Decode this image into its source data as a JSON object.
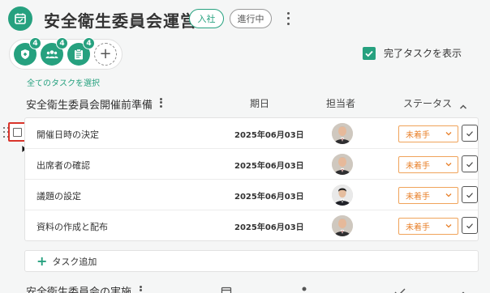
{
  "header": {
    "title": "安全衛生委員会運営",
    "join_label": "入社",
    "progress_label": "進行中"
  },
  "filters": {
    "badges": [
      "4",
      "4",
      "4"
    ],
    "icons": [
      "shield-plus-icon",
      "group-icon",
      "clipboard-icon"
    ],
    "add": "+"
  },
  "show_completed": {
    "label": "完了タスクを表示",
    "checked": true
  },
  "select_all_label": "全てのタスクを選択",
  "section": {
    "title": "安全衛生委員会開催前準備",
    "columns": {
      "date": "期日",
      "assignee": "担当者",
      "status": "ステータス"
    }
  },
  "tasks": [
    {
      "name": "開催日時の決定",
      "date": "2025年06月03日",
      "status": "未着手"
    },
    {
      "name": "出席者の確認",
      "date": "2025年06月03日",
      "status": "未着手"
    },
    {
      "name": "議題の設定",
      "date": "2025年06月03日",
      "status": "未着手"
    },
    {
      "name": "資料の作成と配布",
      "date": "2025年06月03日",
      "status": "未着手"
    }
  ],
  "add_task_label": "タスク追加",
  "next_section": {
    "title": "安全衛生委員会の実施"
  },
  "colors": {
    "accent": "#26a17f",
    "status_orange": "#e8802a",
    "highlight_red": "#d9342b"
  }
}
